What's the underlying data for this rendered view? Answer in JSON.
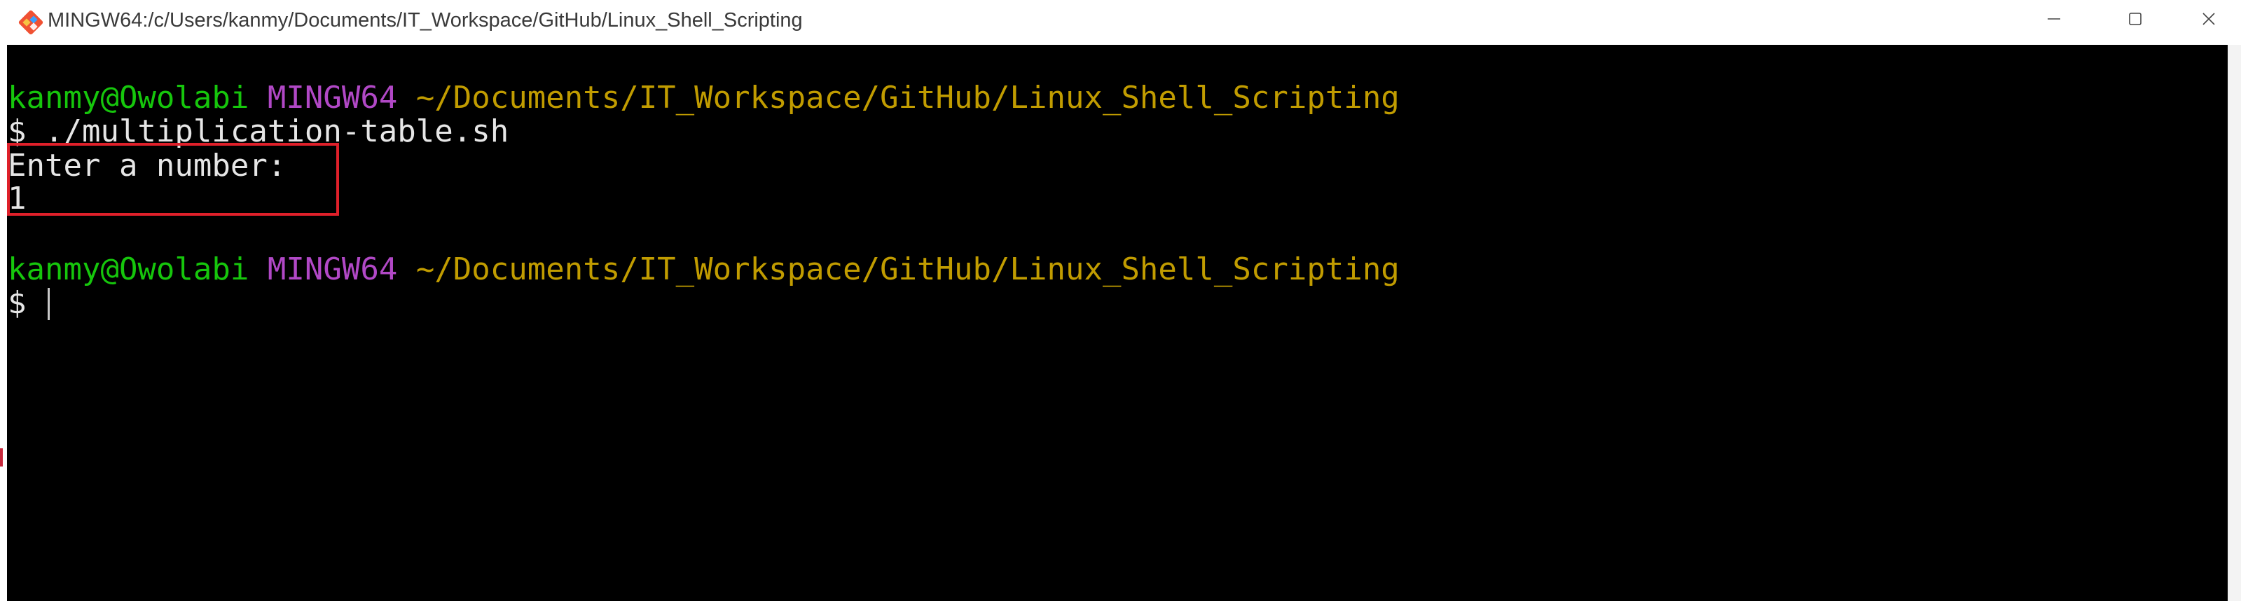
{
  "window": {
    "title": "MINGW64:/c/Users/kanmy/Documents/IT_Workspace/GitHub/Linux_Shell_Scripting",
    "app_icon": "git-bash-icon",
    "controls": {
      "minimize_icon": "minimize-icon",
      "maximize_icon": "maximize-icon",
      "close_icon": "close-icon"
    }
  },
  "terminal": {
    "prompt1": {
      "user": "kanmy@Owolabi",
      "host": "MINGW64",
      "path": "~/Documents/IT_Workspace/GitHub/Linux_Shell_Scripting"
    },
    "command1": "$ ./multiplication-table.sh",
    "output_prompt": "Enter a number:",
    "output_value": "1",
    "prompt2": {
      "user": "kanmy@Owolabi",
      "host": "MINGW64",
      "path": "~/Documents/IT_Workspace/GitHub/Linux_Shell_Scripting"
    },
    "command2": "$ "
  },
  "colors": {
    "user": "#16c60c",
    "host": "#b148c6",
    "path": "#c19c00",
    "text": "#e6e6e6",
    "background": "#000000",
    "highlight": "#e0202a"
  }
}
